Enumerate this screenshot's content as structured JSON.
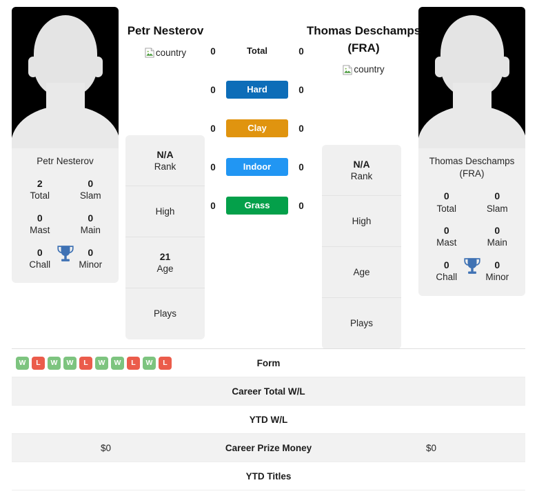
{
  "players": {
    "left": {
      "heading": "Petr Nesterov",
      "card_name": "Petr Nesterov",
      "country_alt": "country",
      "avatar_name": "player-photo",
      "titles": [
        {
          "num": "2",
          "label": "Total"
        },
        {
          "num": "0",
          "label": "Slam"
        },
        {
          "num": "0",
          "label": "Mast"
        },
        {
          "num": "0",
          "label": "Main"
        },
        {
          "num": "0",
          "label": "Chall"
        },
        {
          "num": "0",
          "label": "Minor"
        }
      ],
      "info": [
        {
          "value": "N/A",
          "label": "Rank"
        },
        {
          "value": "",
          "label": "High"
        },
        {
          "value": "21",
          "label": "Age"
        },
        {
          "value": "",
          "label": "Plays"
        }
      ]
    },
    "right": {
      "heading": "Thomas Deschamps (FRA)",
      "card_name": "Thomas Deschamps (FRA)",
      "country_alt": "country",
      "avatar_name": "player-photo",
      "titles": [
        {
          "num": "0",
          "label": "Total"
        },
        {
          "num": "0",
          "label": "Slam"
        },
        {
          "num": "0",
          "label": "Mast"
        },
        {
          "num": "0",
          "label": "Main"
        },
        {
          "num": "0",
          "label": "Chall"
        },
        {
          "num": "0",
          "label": "Minor"
        }
      ],
      "info": [
        {
          "value": "N/A",
          "label": "Rank"
        },
        {
          "value": "",
          "label": "High"
        },
        {
          "value": "",
          "label": "Age"
        },
        {
          "value": "",
          "label": "Plays"
        }
      ]
    }
  },
  "surfaces": [
    {
      "label": "Total",
      "left": "0",
      "right": "0",
      "color": "",
      "plain": true
    },
    {
      "label": "Hard",
      "left": "0",
      "right": "0",
      "color": "#0d6db8",
      "plain": false
    },
    {
      "label": "Clay",
      "left": "0",
      "right": "0",
      "color": "#e0940f",
      "plain": false
    },
    {
      "label": "Indoor",
      "left": "0",
      "right": "0",
      "color": "#2196f3",
      "plain": false
    },
    {
      "label": "Grass",
      "left": "0",
      "right": "0",
      "color": "#04a04a",
      "plain": false
    }
  ],
  "comparison_rows": [
    {
      "label": "Form",
      "striped": false,
      "left_value": "",
      "right_value": "",
      "left_form": [
        "W",
        "L",
        "W",
        "W",
        "L",
        "W",
        "W",
        "L",
        "W",
        "L"
      ],
      "right_form": []
    },
    {
      "label": "Career Total W/L",
      "striped": true,
      "left_value": "",
      "right_value": "",
      "left_form": [],
      "right_form": []
    },
    {
      "label": "YTD W/L",
      "striped": false,
      "left_value": "",
      "right_value": "",
      "left_form": [],
      "right_form": []
    },
    {
      "label": "Career Prize Money",
      "striped": true,
      "left_value": "$0",
      "right_value": "$0",
      "left_form": [],
      "right_form": []
    },
    {
      "label": "YTD Titles",
      "striped": false,
      "left_value": "",
      "right_value": "",
      "left_form": [],
      "right_form": []
    }
  ],
  "colors": {
    "hard": "#0d6db8",
    "clay": "#e0940f",
    "indoor": "#2196f3",
    "grass": "#04a04a",
    "win": "#7dc47f",
    "loss": "#eb5c4b",
    "trophy": "#3f72b4",
    "panel": "#f0f0f0"
  }
}
